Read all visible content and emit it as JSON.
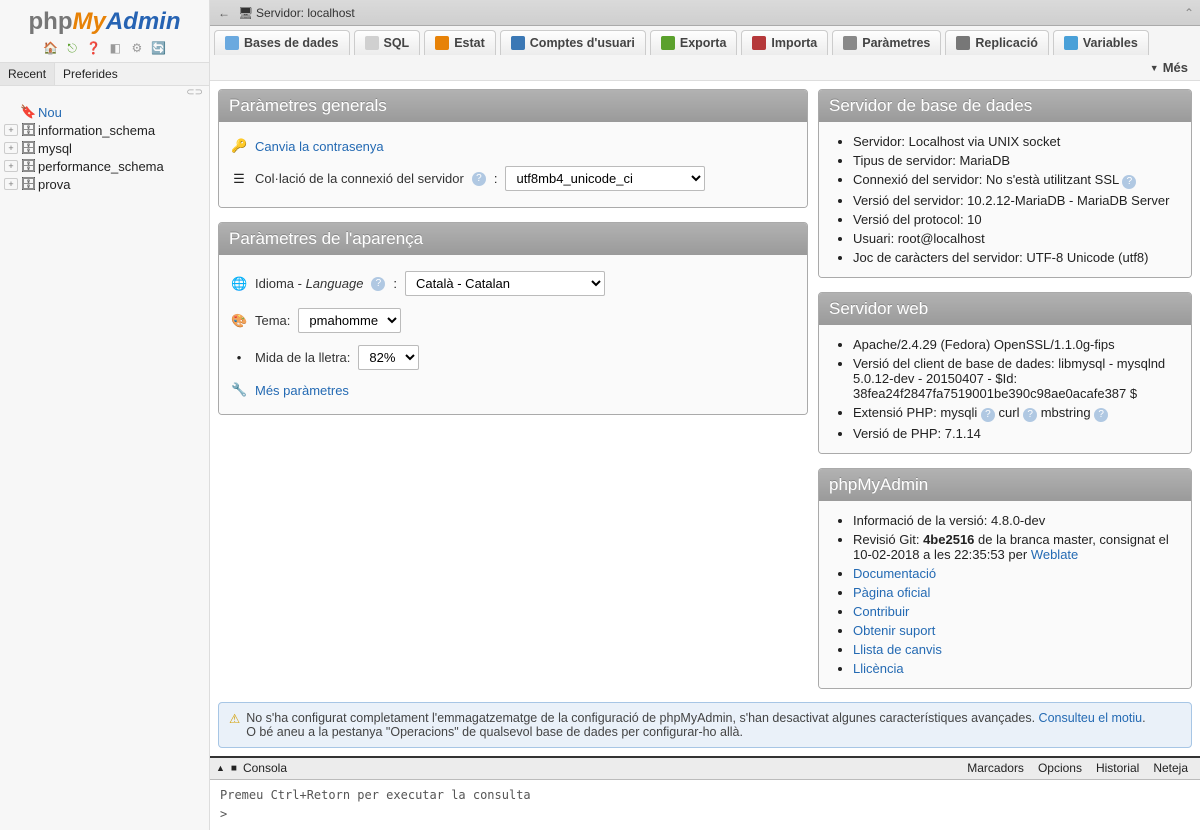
{
  "logo": {
    "p1": "php",
    "p2": "My",
    "p3": "Admin"
  },
  "quick_icons": [
    "home-icon",
    "logout-icon",
    "help-icon",
    "sql-icon",
    "refresh-icon",
    "reload-icon"
  ],
  "sidebar_tabs": {
    "recent": "Recent",
    "favorites": "Preferides"
  },
  "tree": {
    "new": {
      "label": "Nou"
    },
    "items": [
      {
        "label": "information_schema"
      },
      {
        "label": "mysql"
      },
      {
        "label": "performance_schema"
      },
      {
        "label": "prova"
      }
    ]
  },
  "server_bar": {
    "back": "←",
    "label": "Servidor: localhost"
  },
  "topnav": [
    {
      "id": "databases",
      "label": "Bases de dades",
      "color": "#6aa9df"
    },
    {
      "id": "sql",
      "label": "SQL",
      "color": "#b0b0b0"
    },
    {
      "id": "status",
      "label": "Estat",
      "color": "#e78207"
    },
    {
      "id": "users",
      "label": "Comptes d'usuari",
      "color": "#3b78b5"
    },
    {
      "id": "export",
      "label": "Exporta",
      "color": "#5aa02c"
    },
    {
      "id": "import",
      "label": "Importa",
      "color": "#b5383a"
    },
    {
      "id": "settings",
      "label": "Paràmetres",
      "color": "#7a7a7a"
    },
    {
      "id": "replication",
      "label": "Replicació",
      "color": "#6a6a6a"
    },
    {
      "id": "variables",
      "label": "Variables",
      "color": "#49a0d8"
    }
  ],
  "more_label": "Més",
  "panels": {
    "general": {
      "title": "Paràmetres generals",
      "change_pw": "Canvia la contrasenya",
      "collation_label": "Col·lació de la connexió del servidor",
      "collation_value": "utf8mb4_unicode_ci"
    },
    "appearance": {
      "title": "Paràmetres de l'aparença",
      "language_label": "Idioma - ",
      "language_label_em": "Language",
      "language_value": "Català - Catalan",
      "theme_label": "Tema:",
      "theme_value": "pmahomme",
      "fontsize_label": "Mida de la lletra:",
      "fontsize_value": "82%",
      "more_settings": "Més paràmetres"
    },
    "db_server": {
      "title": "Servidor de base de dades",
      "items": [
        "Servidor: Localhost via UNIX socket",
        "Tipus de servidor: MariaDB",
        "Connexió del servidor: No s'està utilitzant SSL",
        "Versió del servidor: 10.2.12-MariaDB - MariaDB Server",
        "Versió del protocol: 10",
        "Usuari: root@localhost",
        "Joc de caràcters del servidor: UTF-8 Unicode (utf8)"
      ],
      "ssl_help_index": 2
    },
    "web_server": {
      "title": "Servidor web",
      "items": [
        "Apache/2.4.29 (Fedora) OpenSSL/1.1.0g-fips",
        "Versió del client de base de dades: libmysql - mysqlnd 5.0.12-dev - 20150407 - $Id: 38fea24f2847fa7519001be390c98ae0acafe387 $",
        "Extensió PHP: mysqli  curl  mbstring",
        "Versió de PHP: 7.1.14"
      ]
    },
    "pma": {
      "title": "phpMyAdmin",
      "version": "Informació de la versió: 4.8.0-dev",
      "git_prefix": "Revisió Git: ",
      "git_hash": "4be2516",
      "git_mid": " de la branca master, consignat el 10-02-2018 a les 22:35:53 per ",
      "git_author": "Weblate",
      "links": [
        "Documentació",
        "Pàgina oficial",
        "Contribuir",
        "Obtenir suport",
        "Llista de canvis",
        "Llicència"
      ]
    }
  },
  "notice": {
    "text": "No s'ha configurat completament l'emmagatzematge de la configuració de phpMyAdmin, s'han desactivat algunes característiques avançades. ",
    "link": "Consulteu el motiu",
    "text2": ".",
    "text3": "O bé aneu a la pestanya \"Operacions\" de qualsevol base de dades per configurar-ho allà."
  },
  "console": {
    "label": "Consola",
    "menu": [
      "Marcadors",
      "Opcions",
      "Historial",
      "Neteja"
    ],
    "hint": "Premeu Ctrl+Retorn per executar la consulta",
    "prompt": ">"
  }
}
